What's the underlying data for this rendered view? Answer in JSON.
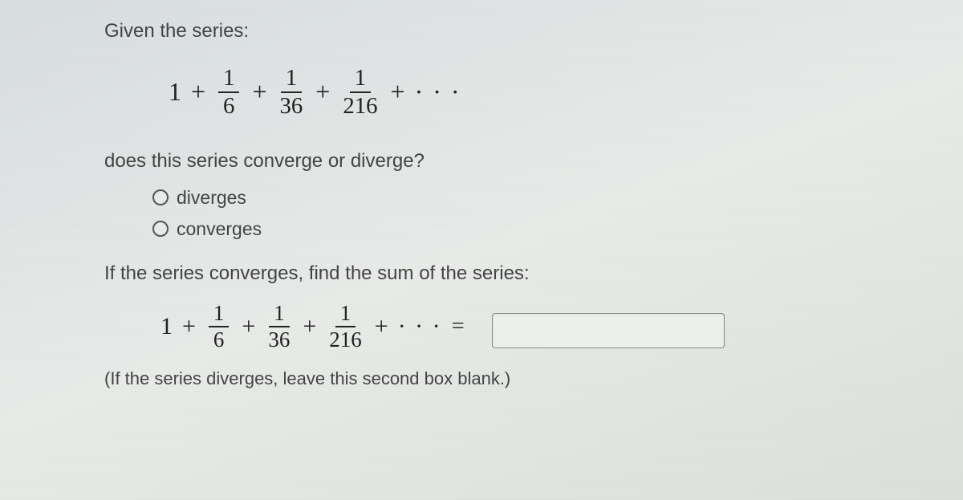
{
  "prompt": "Given the series:",
  "series": {
    "lead": "1",
    "terms": [
      {
        "num": "1",
        "den": "6"
      },
      {
        "num": "1",
        "den": "36"
      },
      {
        "num": "1",
        "den": "216"
      }
    ],
    "plus": "+",
    "ellipsis": "· · ·"
  },
  "question": "does this series converge or diverge?",
  "option1": "diverges",
  "option2": "converges",
  "instruction": "If the series converges, find the sum of the series:",
  "equals": "=",
  "hint": "(If the series diverges, leave this second box blank.)",
  "sum_value": ""
}
